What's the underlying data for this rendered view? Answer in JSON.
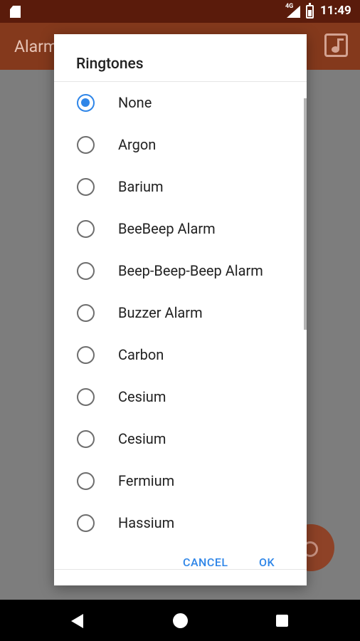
{
  "status_bar": {
    "network": "4G",
    "time": "11:49"
  },
  "app": {
    "title": "Alarm"
  },
  "dialog": {
    "title": "Ringtones",
    "options": [
      {
        "label": "None",
        "selected": true
      },
      {
        "label": "Argon",
        "selected": false
      },
      {
        "label": "Barium",
        "selected": false
      },
      {
        "label": "BeeBeep Alarm",
        "selected": false
      },
      {
        "label": "Beep-Beep-Beep Alarm",
        "selected": false
      },
      {
        "label": "Buzzer Alarm",
        "selected": false
      },
      {
        "label": "Carbon",
        "selected": false
      },
      {
        "label": "Cesium",
        "selected": false
      },
      {
        "label": "Cesium",
        "selected": false
      },
      {
        "label": "Fermium",
        "selected": false
      },
      {
        "label": "Hassium",
        "selected": false
      }
    ],
    "cancel_label": "CANCEL",
    "ok_label": "OK"
  },
  "colors": {
    "accent": "#2f86e8",
    "status_bar": "#5a1b0b",
    "app_bar": "#84391c",
    "scrim": "#7a7a7a"
  },
  "icons": {
    "sd_card": "sd-card-icon",
    "signal": "signal-icon",
    "battery": "battery-icon",
    "music": "music-library-icon",
    "fab": "add-alarm-icon",
    "back": "back-icon",
    "home": "home-icon",
    "recents": "recents-icon"
  }
}
